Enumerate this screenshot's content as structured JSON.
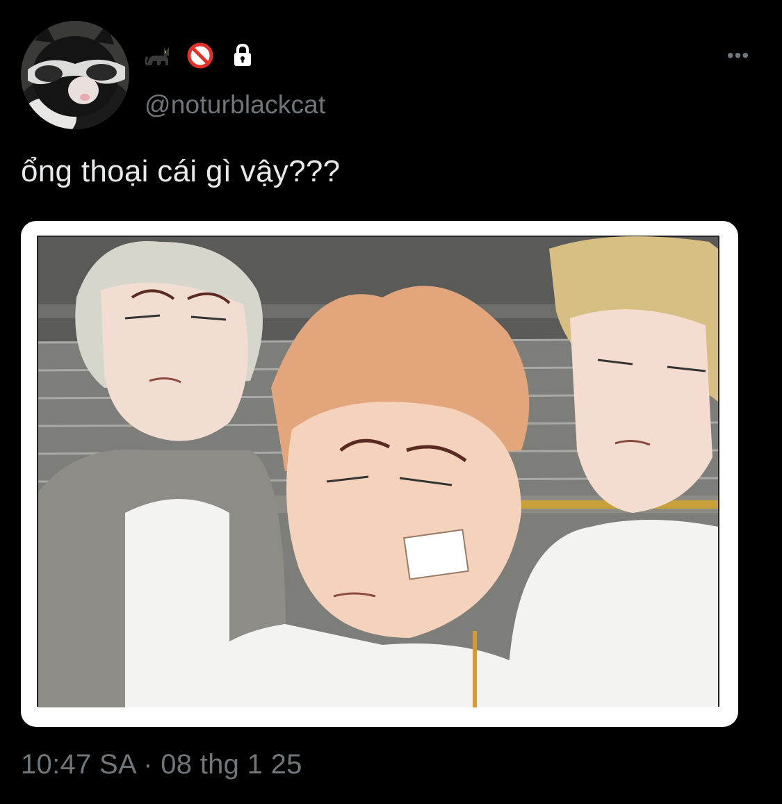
{
  "tweet": {
    "display_name_icons": [
      "black-cat-icon",
      "prohibited-icon",
      "lock-icon"
    ],
    "handle": "@noturblackcat",
    "text": "ổng thoại cái gì vậy???",
    "timestamp": "10:47 SA · 08 thg 1 25",
    "more_label": "•••"
  },
  "colors": {
    "background": "#000000",
    "text_primary": "#e7e9ea",
    "text_secondary": "#71767b"
  }
}
